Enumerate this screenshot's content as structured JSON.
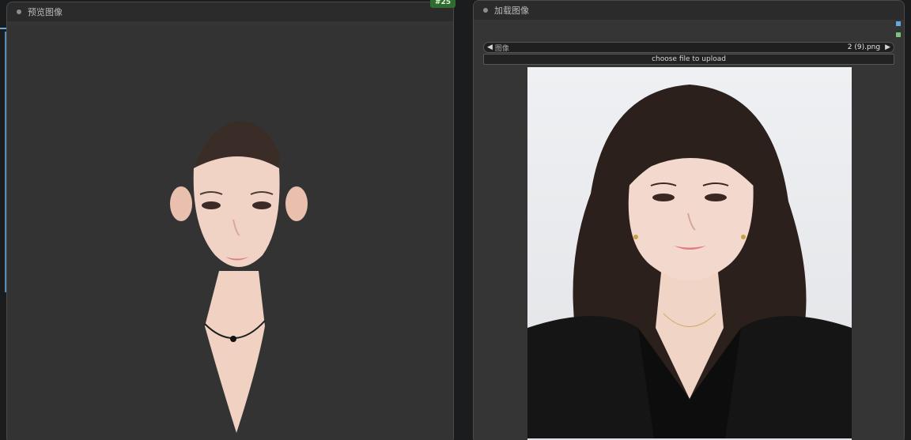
{
  "nodes": {
    "preview": {
      "title": "预览图像",
      "badge": "#25"
    },
    "load": {
      "title": "加载图像",
      "image_combo": {
        "label": "图像",
        "value": "2 (9).png",
        "left_arrow": "◀",
        "right_arrow": "▶"
      },
      "upload_label": "choose file to upload"
    }
  },
  "colors": {
    "node_bg": "#353535",
    "title_bg": "#2b2b2b",
    "wire": "#65a7e0",
    "badge_bg": "#2f6b2e"
  },
  "icons": {
    "status_dot": "dot",
    "prev_arrow": "left-triangle",
    "next_arrow": "right-triangle"
  }
}
